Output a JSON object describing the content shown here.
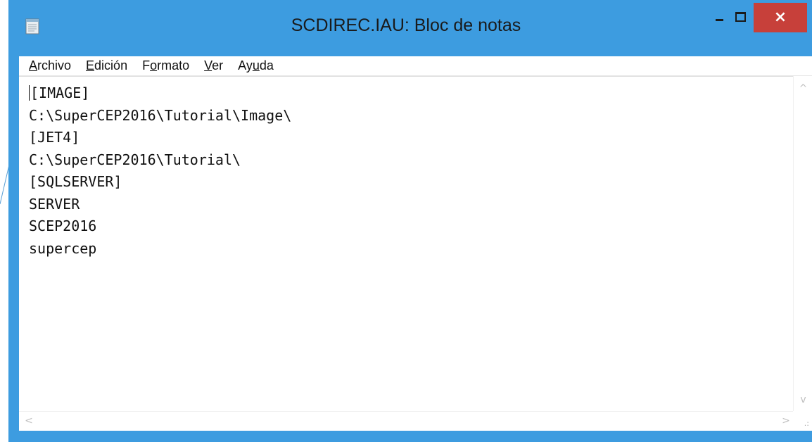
{
  "window": {
    "title": "SCDIREC.IAU: Bloc de notas",
    "close_symbol": "×",
    "accent_color": "#3d9ce0",
    "close_color": "#c7403a"
  },
  "menu": {
    "items": [
      {
        "underlined": "A",
        "rest": "rchivo"
      },
      {
        "underlined": "E",
        "rest": "dición"
      },
      {
        "prefix": "F",
        "underlined": "o",
        "rest": "rmato"
      },
      {
        "underlined": "V",
        "rest": "er"
      },
      {
        "prefix": "Ay",
        "underlined": "u",
        "rest": "da"
      }
    ]
  },
  "editor": {
    "lines": [
      "[IMAGE]",
      "C:\\SuperCEP2016\\Tutorial\\Image\\",
      "[JET4]",
      "C:\\SuperCEP2016\\Tutorial\\",
      "[SQLSERVER]",
      "SERVER",
      "SCEP2016",
      "supercep"
    ]
  },
  "scroll": {
    "up": "^",
    "down": "v",
    "left": "<",
    "right": ">",
    "grip": ".:"
  }
}
